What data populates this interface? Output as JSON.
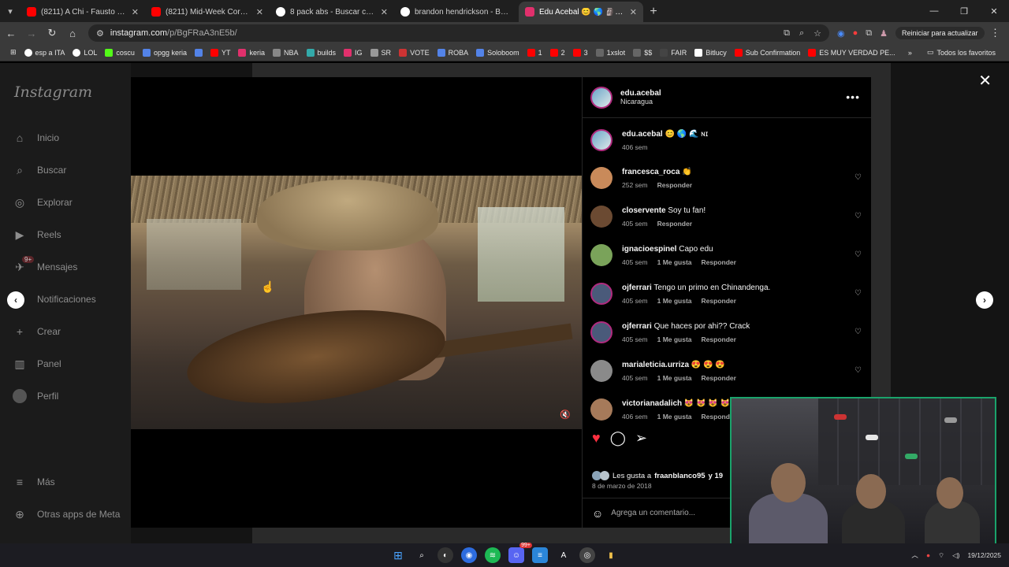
{
  "browser": {
    "tabs": [
      {
        "title": "(8211) A Chi - Fausto Leali - Yo",
        "color": "#ff0000"
      },
      {
        "title": "(8211) Mid-Week Core 🔥 Let's",
        "color": "#ff0000"
      },
      {
        "title": "8 pack abs - Buscar con Google",
        "color": "#4285f4"
      },
      {
        "title": "brandon hendrickson - Buscar c",
        "color": "#4285f4"
      },
      {
        "title": "Edu Acebal 😊 🌎 🗿 🌊 (@edu",
        "color": "#e1306c"
      }
    ],
    "url_host": "instagram.com",
    "url_path": "/p/BgFRaA3nE5b/",
    "restart_label": "Reiniciar para actualizar",
    "bookmarks": [
      {
        "label": "esp a ITA",
        "color": "#4285f4"
      },
      {
        "label": "LOL",
        "color": "#4285f4"
      },
      {
        "label": "coscu",
        "color": "#53fc18"
      },
      {
        "label": "opgg keria",
        "color": "#5383e8"
      },
      {
        "label": "",
        "color": "#5383e8"
      },
      {
        "label": "YT",
        "color": "#ff0000"
      },
      {
        "label": "keria",
        "color": "#e1306c"
      },
      {
        "label": "NBA",
        "color": "#888888"
      },
      {
        "label": "builds",
        "color": "#33aaaa"
      },
      {
        "label": "IG",
        "color": "#e1306c"
      },
      {
        "label": "SR",
        "color": "#999999"
      },
      {
        "label": "VOTE",
        "color": "#cc3333"
      },
      {
        "label": "ROBA",
        "color": "#5383e8"
      },
      {
        "label": "Soloboom",
        "color": "#5383e8"
      },
      {
        "label": "1",
        "color": "#ff0000"
      },
      {
        "label": "2",
        "color": "#ff0000"
      },
      {
        "label": "3",
        "color": "#ff0000"
      },
      {
        "label": "1xslot",
        "color": "#666666"
      },
      {
        "label": "$$",
        "color": "#666666"
      },
      {
        "label": "FAIR",
        "color": "#222222"
      },
      {
        "label": "Bitlucy",
        "color": "#ffffff"
      },
      {
        "label": "Sub Confirmation",
        "color": "#ff0000"
      },
      {
        "label": "ES MUY VERDAD PE...",
        "color": "#ff0000"
      }
    ],
    "all_favorites": "Todos los favoritos"
  },
  "instagram": {
    "logo": "Instagram",
    "nav": [
      {
        "label": "Inicio",
        "icon": "home-icon",
        "glyph": "⌂"
      },
      {
        "label": "Buscar",
        "icon": "search-icon",
        "glyph": "⌕"
      },
      {
        "label": "Explorar",
        "icon": "compass-icon",
        "glyph": "◎"
      },
      {
        "label": "Reels",
        "icon": "reels-icon",
        "glyph": "▶"
      },
      {
        "label": "Mensajes",
        "icon": "messages-icon",
        "glyph": "✈",
        "badge": "9+"
      },
      {
        "label": "Notificaciones",
        "icon": "heart-icon",
        "glyph": "♡"
      },
      {
        "label": "Crear",
        "icon": "plus-icon",
        "glyph": "+"
      },
      {
        "label": "Panel",
        "icon": "dashboard-icon",
        "glyph": "▥"
      },
      {
        "label": "Perfil",
        "icon": "profile-avatar",
        "glyph": "●"
      }
    ],
    "more": "Más",
    "meta_apps": "Otras apps de Meta",
    "post": {
      "author": "edu.acebal",
      "location": "Nicaragua",
      "caption_user": "edu.acebal",
      "caption": "😊 🌎 🌊 ɴɪ",
      "caption_age": "406 sem",
      "comments": [
        {
          "user": "francesca_roca",
          "text": "👏",
          "age": "252 sem",
          "likes": "",
          "reply": "Responder",
          "avatar": "#c98a5a"
        },
        {
          "user": "closervente",
          "text": "Soy tu fan!",
          "age": "405 sem",
          "likes": "",
          "reply": "Responder",
          "avatar": "#6b4a32"
        },
        {
          "user": "ignacioespinel",
          "text": "Capo edu",
          "age": "405 sem",
          "likes": "1 Me gusta",
          "reply": "Responder",
          "avatar": "#7aa35a"
        },
        {
          "user": "ojferrari",
          "text": "Tengo un primo en Chinandenga.",
          "age": "405 sem",
          "likes": "1 Me gusta",
          "reply": "Responder",
          "avatar": "#4a5a7a"
        },
        {
          "user": "ojferrari",
          "text": "Que haces por ahi?? Crack",
          "age": "405 sem",
          "likes": "1 Me gusta",
          "reply": "Responder",
          "avatar": "#4a5a7a"
        },
        {
          "user": "marialeticia.urriza",
          "text": "😍 😍 😍",
          "age": "405 sem",
          "likes": "1 Me gusta",
          "reply": "Responder",
          "avatar": "#8a8a8a"
        },
        {
          "user": "victorianadalich",
          "text": "😻 😻 😻 😻",
          "age": "406 sem",
          "likes": "1 Me gusta",
          "reply": "Responder",
          "avatar": "#a67a5a"
        }
      ],
      "likes_text": "Les gusta a",
      "likes_user": "fraanblanco95",
      "likes_more": "y 19",
      "date": "8 de marzo de 2018",
      "add_comment_placeholder": "Agrega un comentario..."
    }
  },
  "taskbar": {
    "apps": [
      "start",
      "search",
      "steam",
      "chrome",
      "spotify",
      "discord",
      "notepad",
      "text",
      "app",
      "files"
    ],
    "badge": "99+",
    "date": "19/12/2025"
  },
  "colors": {
    "like_red": "#ff3040",
    "accent_green": "#1aa36b"
  }
}
